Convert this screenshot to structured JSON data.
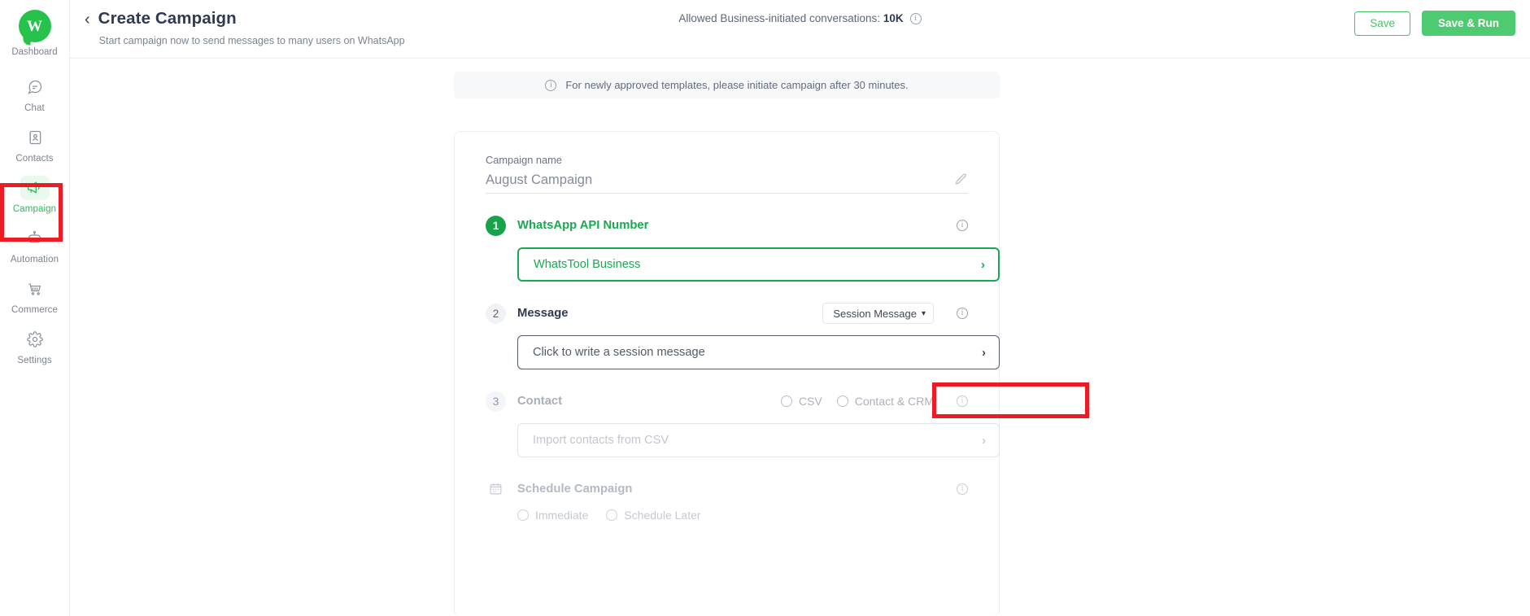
{
  "sidebar": {
    "logo": {
      "icon": "whatstool-logo-icon",
      "label": "Dashboard"
    },
    "items": [
      {
        "label": "Chat",
        "icon": "chat-icon",
        "active": false
      },
      {
        "label": "Contacts",
        "icon": "contacts-icon",
        "active": false
      },
      {
        "label": "Campaign",
        "icon": "megaphone-icon",
        "active": true
      },
      {
        "label": "Automation",
        "icon": "robot-icon",
        "active": false
      },
      {
        "label": "Commerce",
        "icon": "cart-icon",
        "active": false
      },
      {
        "label": "Settings",
        "icon": "gear-icon",
        "active": false
      }
    ]
  },
  "header": {
    "back_icon": "chevron-left-icon",
    "title": "Create Campaign",
    "subtitle": "Start campaign now to send messages to many users on WhatsApp",
    "allowed_label": "Allowed Business-initiated conversations:",
    "allowed_value": "10K",
    "info_icon": "info-icon",
    "save_label": "Save",
    "save_run_label": "Save & Run"
  },
  "notice": {
    "icon": "info-icon",
    "text": "For newly approved templates, please initiate campaign after 30 minutes."
  },
  "form": {
    "campaign_name_label": "Campaign name",
    "campaign_name_value": "August Campaign",
    "edit_icon": "pencil-icon",
    "step1": {
      "badge": "1",
      "title": "WhatsApp API Number",
      "info_icon": "info-icon",
      "selected_value": "WhatsTool Business",
      "chevron_icon": "chevron-right-icon"
    },
    "step2": {
      "badge": "2",
      "title": "Message",
      "message_type": "Session Message",
      "caret_icon": "chevron-down-icon",
      "info_icon": "info-icon",
      "placeholder": "Click to write a session message",
      "chevron_icon": "chevron-right-icon"
    },
    "step3": {
      "badge": "3",
      "title": "Contact",
      "option_csv": "CSV",
      "option_crm": "Contact & CRM",
      "info_icon": "info-icon",
      "placeholder": "Import contacts from CSV",
      "chevron_icon": "chevron-right-icon"
    },
    "schedule": {
      "icon": "calendar-icon",
      "title": "Schedule Campaign",
      "info_icon": "info-icon",
      "option_immediate": "Immediate",
      "option_later": "Schedule Later"
    }
  },
  "colors": {
    "brand_green": "#27c24c",
    "accent_green": "#1aa851",
    "highlight_red": "#ed1c24",
    "text_dark": "#2f3a52",
    "text_muted": "#7b8394"
  }
}
